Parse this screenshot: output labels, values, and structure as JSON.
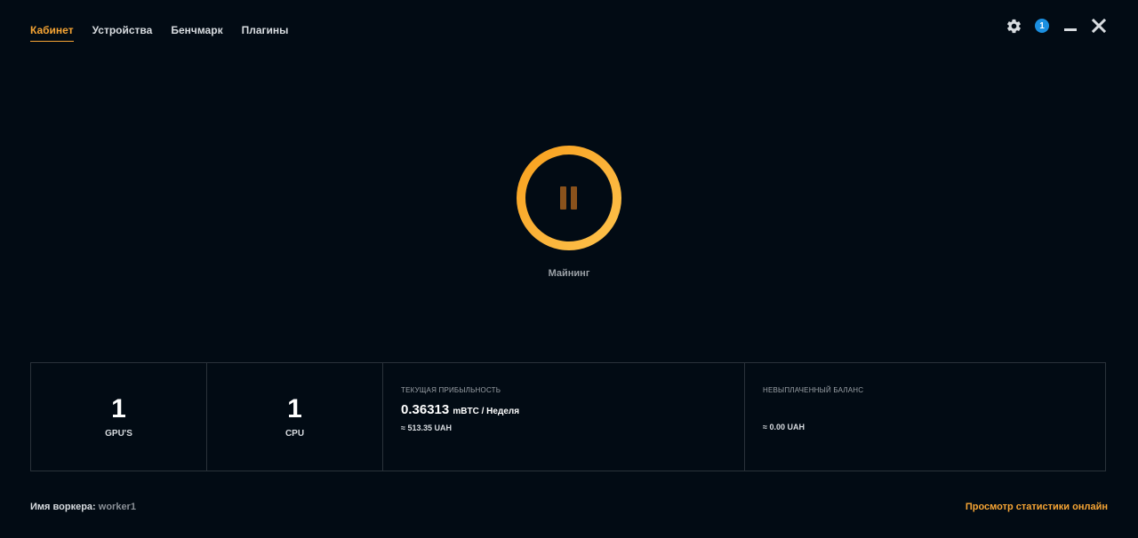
{
  "nav": {
    "tabs": [
      {
        "label": "Кабинет",
        "active": true
      },
      {
        "label": "Устройства",
        "active": false
      },
      {
        "label": "Бенчмарк",
        "active": false
      },
      {
        "label": "Плагины",
        "active": false
      }
    ]
  },
  "window_controls": {
    "settings_icon": "gear-icon",
    "notification_count": "1",
    "minimize_icon": "minimize-icon",
    "close_icon": "close-icon"
  },
  "mining": {
    "icon": "pause-icon",
    "label": "Майнинг",
    "accent_color": "#f89f1b"
  },
  "stats": {
    "gpus": {
      "value": "1",
      "label": "GPU'S"
    },
    "cpu": {
      "value": "1",
      "label": "CPU"
    },
    "profit": {
      "title": "ТЕКУЩАЯ ПРИБЫЛЬНОСТЬ",
      "value": "0.36313",
      "unit": "mBTC / Неделя",
      "approx": "≈ 513.35 UAH"
    },
    "balance": {
      "title": "НЕВЫПЛАЧЕННЫЙ БАЛАНС",
      "approx": "≈ 0.00 UAH"
    }
  },
  "footer": {
    "worker_label": "Имя воркера:",
    "worker_name": "worker1",
    "stats_link": "Просмотр статистики онлайн"
  },
  "colors": {
    "background": "#020b14",
    "accent": "#f7a534",
    "badge": "#1b8fe0"
  }
}
